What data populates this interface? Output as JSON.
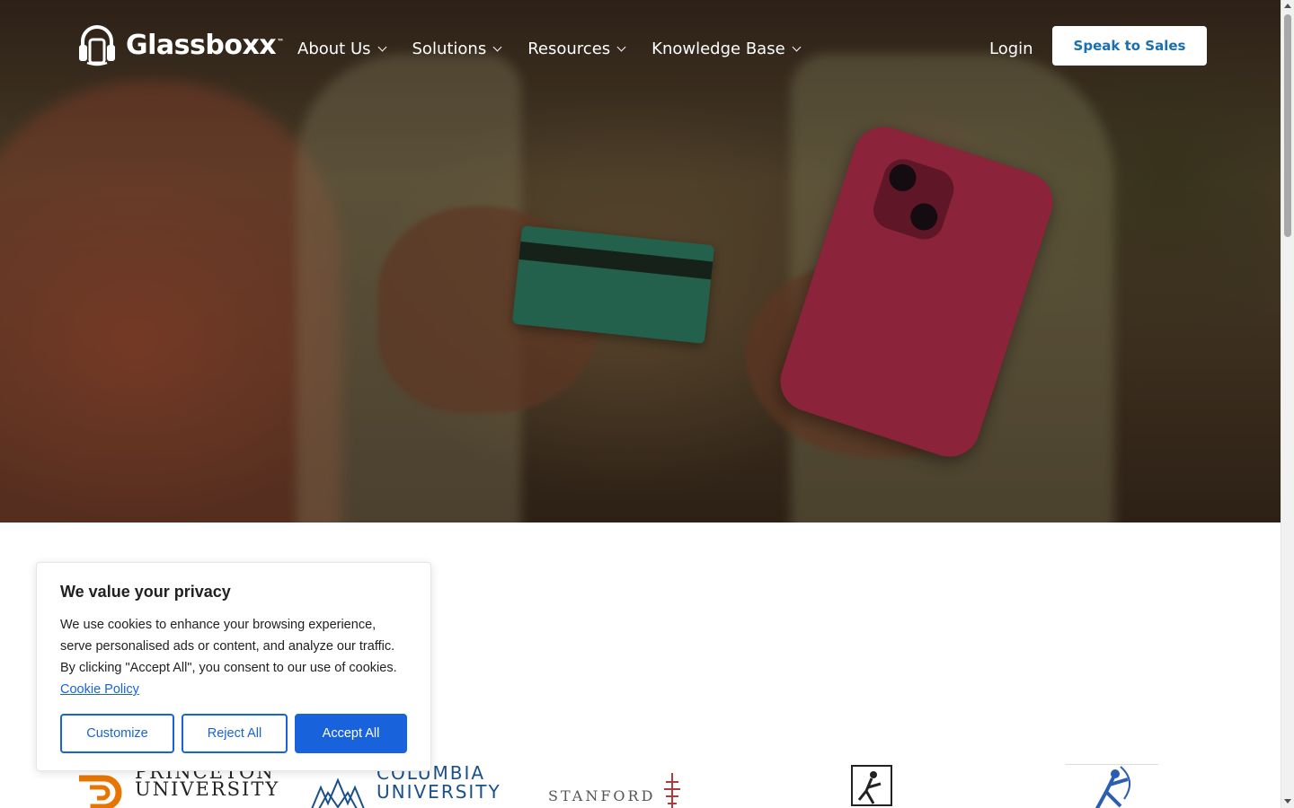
{
  "header": {
    "logo_text": "Glassboxx",
    "logo_tm": "™",
    "nav": [
      {
        "label": "About Us"
      },
      {
        "label": "Solutions"
      },
      {
        "label": "Resources"
      },
      {
        "label": "Knowledge Base"
      }
    ],
    "login_label": "Login",
    "cta_label": "Speak to Sales"
  },
  "cookie_banner": {
    "title": "We value your privacy",
    "body": "We use cookies to enhance your browsing experience, serve personalised ads or content, and analyze our traffic. By clicking \"Accept All\", you consent to our use of cookies.",
    "policy_link": "Cookie Policy",
    "buttons": {
      "customize": "Customize",
      "reject": "Reject All",
      "accept": "Accept All"
    }
  },
  "partners": {
    "princeton": [
      "PRINCETON",
      "UNIVERSITY"
    ],
    "columbia": [
      "COLUMBIA",
      "UNIVERSITY"
    ],
    "stanford": "STANFORD"
  },
  "colors": {
    "accent": "#1863dc",
    "cta_text": "#1a6fb0",
    "princeton_orange": "#e77500",
    "columbia_blue": "#1b4f8a",
    "stanford_red": "#b23a3a"
  }
}
